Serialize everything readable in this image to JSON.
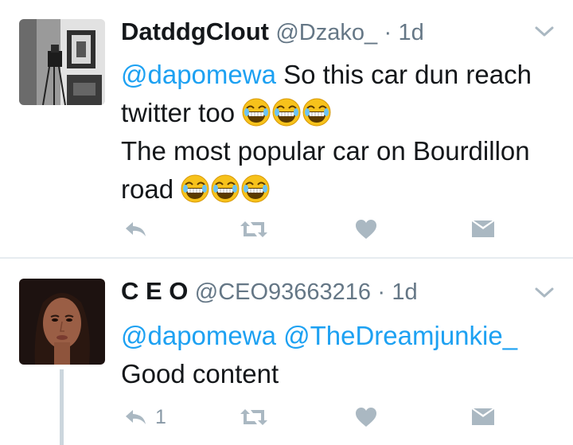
{
  "tweets": [
    {
      "name": "DatddgClout",
      "handle": "@Dzako_",
      "separator": "·",
      "time": "1d",
      "lines": [
        {
          "mention": "@dapomewa",
          "text": " So this car dun reach"
        },
        {
          "mention": "",
          "text": "twitter too"
        },
        {
          "mention": "",
          "text": "The most popular car on Bourdillon"
        },
        {
          "mention": "",
          "text": "road"
        }
      ],
      "emoji": "😂",
      "reply_count": "",
      "icons": [
        "reply-icon",
        "retweet-icon",
        "like-icon",
        "message-icon",
        "chevron-down-icon"
      ]
    },
    {
      "name": "C E O",
      "handle": "@CEO93663216",
      "separator": "·",
      "time": "1d",
      "lines": [
        {
          "mention": "@dapomewa @TheDreamjunkie_",
          "text": ""
        },
        {
          "mention": "",
          "text": "Good content"
        }
      ],
      "reply_count": "1",
      "icons": [
        "reply-icon",
        "retweet-icon",
        "like-icon",
        "message-icon",
        "chevron-down-icon"
      ]
    }
  ],
  "colors": {
    "mention": "#1da1f2",
    "meta": "#657786",
    "action": "#8899a6",
    "divider": "#e6ecf0",
    "emoji": "#f5c518"
  }
}
